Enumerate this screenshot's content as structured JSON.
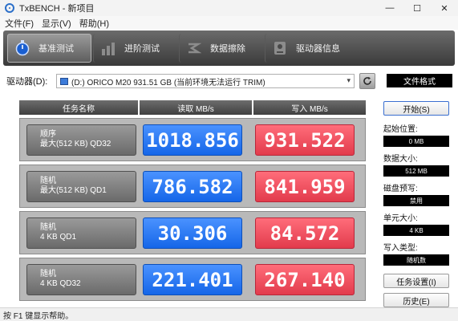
{
  "window": {
    "title": "TxBENCH - 新项目"
  },
  "menu": [
    "文件(F)",
    "显示(V)",
    "帮助(H)"
  ],
  "toolbar": {
    "tabs": [
      {
        "label": "基准测试",
        "icon": "stopwatch-icon"
      },
      {
        "label": "进阶测试",
        "icon": "bar-chart-icon"
      },
      {
        "label": "数据擦除",
        "icon": "eraser-icon"
      },
      {
        "label": "驱动器信息",
        "icon": "drive-info-icon"
      }
    ]
  },
  "drive": {
    "label": "驱动器(D):",
    "selected": "(D:) ORICO M20 931.51 GB (当前环境无法运行 TRIM)",
    "text_mode": "文件格式"
  },
  "results": {
    "headers": {
      "name": "任务名称",
      "read": "读取 MB/s",
      "write": "写入 MB/s"
    },
    "rows": [
      {
        "line1": "顺序",
        "line2": "最大(512 KB) QD32",
        "read": "1018.856",
        "write": "931.522"
      },
      {
        "line1": "随机",
        "line2": "最大(512 KB) QD1",
        "read": "786.582",
        "write": "841.959"
      },
      {
        "line1": "随机",
        "line2": "4 KB QD1",
        "read": "30.306",
        "write": "84.572"
      },
      {
        "line1": "随机",
        "line2": "4 KB QD32",
        "read": "221.401",
        "write": "267.140"
      }
    ]
  },
  "side": {
    "start": "开始(S)",
    "start_pos_label": "起始位置:",
    "start_pos": "0 MB",
    "data_size_label": "数据大小:",
    "data_size": "512 MB",
    "alignment_label": "磁盘预写:",
    "alignment": "禁用",
    "unit_size_label": "单元大小:",
    "unit_size": "4 KB",
    "write_type_label": "写入类型:",
    "write_type": "随机数",
    "task_settings": "任务设置(I)",
    "history": "历史(E)"
  },
  "status": {
    "text": "按 F1 键显示帮助。"
  },
  "colors": {
    "read": "#1e72f0",
    "write": "#e84455",
    "toolbar": "#3a3a3a"
  }
}
